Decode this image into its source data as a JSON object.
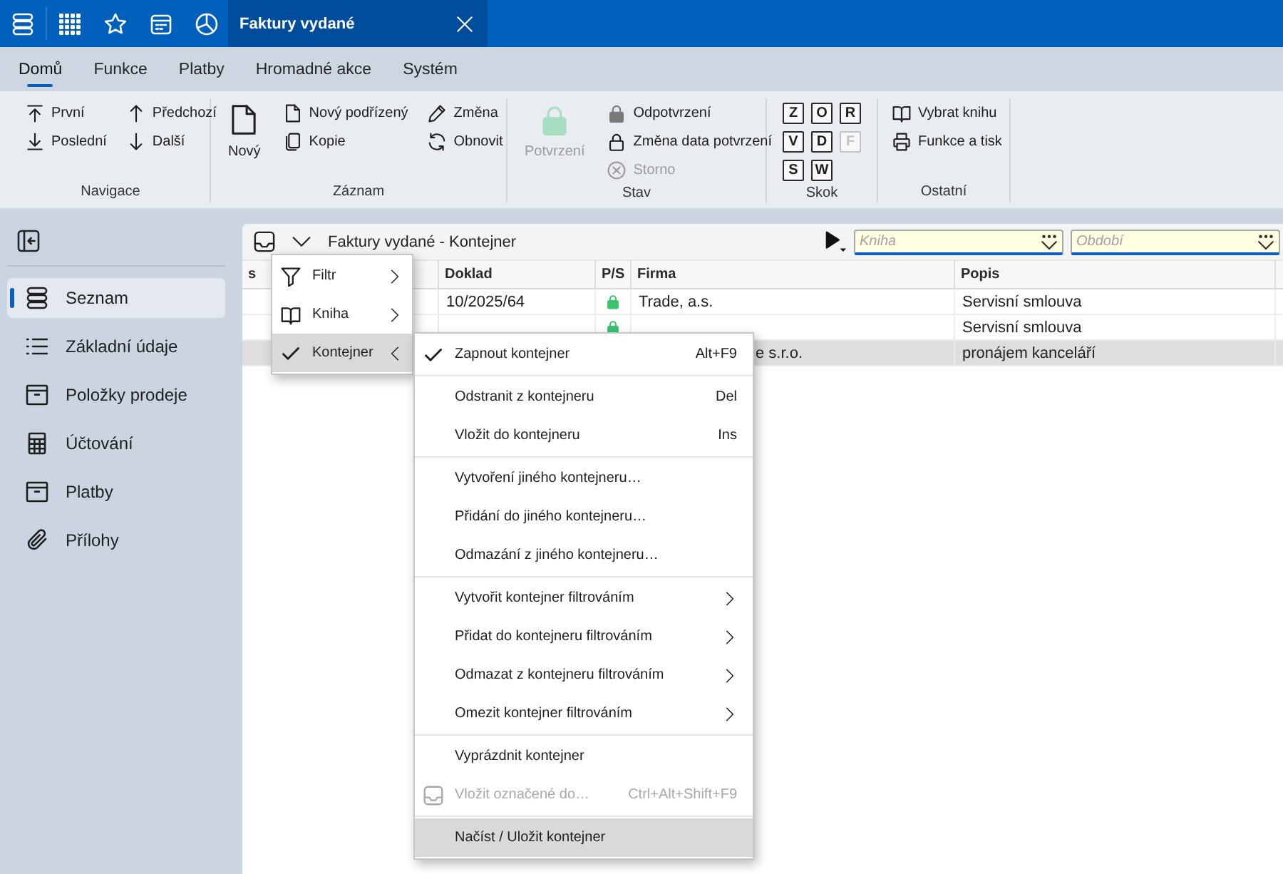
{
  "app_bar": {
    "tabs": [
      {
        "title": "Faktury vydané",
        "selected": true
      }
    ]
  },
  "ribbon_tabs": [
    {
      "label": "Domů",
      "selected": true
    },
    {
      "label": "Funkce",
      "selected": false
    },
    {
      "label": "Platby",
      "selected": false
    },
    {
      "label": "Hromadné akce",
      "selected": false
    },
    {
      "label": "Systém",
      "selected": false
    }
  ],
  "ribbon_groups": [
    {
      "label": "Navigace",
      "kind": "buttons",
      "columns": [
        [
          {
            "label": "První",
            "kind": "small",
            "disabled": false
          },
          {
            "label": "Poslední",
            "kind": "small",
            "disabled": false
          }
        ],
        [
          {
            "label": "Předchozí",
            "kind": "small",
            "disabled": false
          },
          {
            "label": "Další",
            "kind": "small",
            "disabled": false
          }
        ]
      ]
    },
    {
      "label": "Záznam",
      "kind": "buttons",
      "columns": [
        [
          {
            "label": "Nový",
            "kind": "large",
            "disabled": false
          }
        ],
        [
          {
            "label": "Nový podřízený",
            "kind": "small",
            "disabled": false
          },
          {
            "label": "Kopie",
            "kind": "small",
            "disabled": false
          }
        ],
        [
          {
            "label": "Změna",
            "kind": "small",
            "disabled": false
          },
          {
            "label": "Obnovit",
            "kind": "small",
            "disabled": false
          }
        ]
      ]
    },
    {
      "label": "Stav",
      "kind": "buttons",
      "columns": [
        [
          {
            "label": "Potvrzení",
            "kind": "large",
            "disabled": true
          }
        ],
        [
          {
            "label": "Odpotvrzení",
            "kind": "small",
            "disabled": false
          },
          {
            "label": "Změna data potvrzení",
            "kind": "small",
            "disabled": false
          },
          {
            "label": "Storno",
            "kind": "small",
            "disabled": true
          }
        ]
      ]
    },
    {
      "label": "Skok",
      "kind": "keys",
      "columns": [
        [
          {
            "label": "Z",
            "kind": "key",
            "disabled": false
          },
          {
            "label": "O",
            "kind": "key",
            "disabled": false
          },
          {
            "label": "R",
            "kind": "key",
            "disabled": false
          }
        ],
        [
          {
            "label": "V",
            "kind": "key",
            "disabled": false
          },
          {
            "label": "D",
            "kind": "key",
            "disabled": false
          },
          {
            "label": "F",
            "kind": "key",
            "disabled": true
          }
        ],
        [
          {
            "label": "S",
            "kind": "key",
            "disabled": false
          },
          {
            "label": "W",
            "kind": "key",
            "disabled": false
          }
        ]
      ]
    },
    {
      "label": "Ostatní",
      "kind": "buttons",
      "columns": [
        [
          {
            "label": "Vybrat knihu",
            "kind": "small",
            "disabled": false
          },
          {
            "label": "Funkce a tisk",
            "kind": "small",
            "disabled": false
          }
        ]
      ]
    }
  ],
  "sidebar": {
    "items": [
      {
        "label": "Seznam",
        "selected": true
      },
      {
        "label": "Základní údaje",
        "selected": false
      },
      {
        "label": "Položky prodeje",
        "selected": false
      },
      {
        "label": "Účtování",
        "selected": false
      },
      {
        "label": "Platby",
        "selected": false
      },
      {
        "label": "Přílohy",
        "selected": false
      }
    ]
  },
  "list_panel": {
    "title": "Faktury vydané - Kontejner",
    "filters": [
      {
        "placeholder": "Kniha"
      },
      {
        "placeholder": "Období"
      }
    ],
    "table": {
      "columns": [
        "s",
        "Doklad",
        "P/S",
        "Firma",
        "Popis"
      ],
      "rows": [
        {
          "selected": false,
          "doklad": "10/2025/64",
          "locked": true,
          "firma": "Trade, a.s.",
          "firma_partly_hidden": false,
          "popis": "Servisní smlouva"
        },
        {
          "selected": false,
          "locked": true,
          "popis": "Servisní smlouva"
        },
        {
          "selected": true,
          "firma": "e s.r.o.",
          "firma_partly_hidden": true,
          "popis": "pronájem kanceláří"
        }
      ]
    }
  },
  "menu": {
    "items": [
      {
        "label": "Filtr",
        "checked": false,
        "expanded": false,
        "highlighted": false
      },
      {
        "label": "Kniha",
        "checked": false,
        "expanded": false,
        "highlighted": false
      },
      {
        "label": "Kontejner",
        "checked": true,
        "expanded": true,
        "highlighted": true
      }
    ]
  },
  "submenu": {
    "groups": [
      [
        {
          "label": "Zapnout kontejner",
          "shortcut": "Alt+F9",
          "checked": true,
          "disabled": false,
          "highlighted": false,
          "has_submenu": false
        }
      ],
      [
        {
          "label": "Odstranit z kontejneru",
          "shortcut": "Del",
          "checked": false,
          "disabled": false,
          "highlighted": false,
          "has_submenu": false
        },
        {
          "label": "Vložit do kontejneru",
          "shortcut": "Ins",
          "checked": false,
          "disabled": false,
          "highlighted": false,
          "has_submenu": false
        }
      ],
      [
        {
          "label": "Vytvoření jiného kontejneru…",
          "checked": false,
          "disabled": false,
          "highlighted": false,
          "has_submenu": false
        },
        {
          "label": "Přidání do jiného kontejneru…",
          "checked": false,
          "disabled": false,
          "highlighted": false,
          "has_submenu": false
        },
        {
          "label": "Odmazání z jiného kontejneru…",
          "checked": false,
          "disabled": false,
          "highlighted": false,
          "has_submenu": false
        }
      ],
      [
        {
          "label": "Vytvořit kontejner filtrováním",
          "checked": false,
          "disabled": false,
          "highlighted": false,
          "has_submenu": true
        },
        {
          "label": "Přidat do kontejneru filtrováním",
          "checked": false,
          "disabled": false,
          "highlighted": false,
          "has_submenu": true
        },
        {
          "label": "Odmazat z kontejneru filtrováním",
          "checked": false,
          "disabled": false,
          "highlighted": false,
          "has_submenu": true
        },
        {
          "label": "Omezit kontejner filtrováním",
          "checked": false,
          "disabled": false,
          "highlighted": false,
          "has_submenu": true
        }
      ],
      [
        {
          "label": "Vyprázdnit kontejner",
          "checked": false,
          "disabled": false,
          "highlighted": false,
          "has_submenu": false
        },
        {
          "label": "Vložit označené do…",
          "shortcut": "Ctrl+Alt+Shift+F9",
          "checked": false,
          "disabled": true,
          "highlighted": false,
          "has_submenu": false
        }
      ],
      [
        {
          "label": "Načíst / Uložit kontejner",
          "checked": false,
          "disabled": false,
          "highlighted": true,
          "has_submenu": false
        }
      ]
    ]
  }
}
